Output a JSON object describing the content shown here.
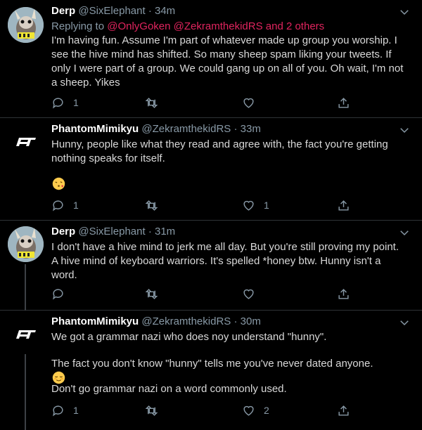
{
  "tweets": [
    {
      "display_name": "Derp",
      "handle": "@SixElephant",
      "sep": "·",
      "time": "34m",
      "replying_label": "Replying to",
      "replying_users": "@OnlyGoken @ZekramthekidRS",
      "replying_and": "and 2 others",
      "text": "I'm having fun. Assume I'm part of whatever made up group you worship. I see the hive mind has shifted. So many sheep spam liking your tweets. If only I were part of a group. We could gang up on all of you. Oh wait, I'm not a sheep. Yikes",
      "reply_count": "1",
      "retweet_count": "",
      "like_count": ""
    },
    {
      "display_name": "PhantomMimikyu",
      "handle": "@ZekramthekidRS",
      "sep": "·",
      "time": "33m",
      "text": "Hunny, people like what they read and agree with, the fact you're getting nothing speaks for itself.",
      "emoji": "face-blowing-kiss",
      "reply_count": "1",
      "retweet_count": "",
      "like_count": "1"
    },
    {
      "display_name": "Derp",
      "handle": "@SixElephant",
      "sep": "·",
      "time": "31m",
      "text": "I don't have a hive mind to jerk me all day. But you're still proving my point. A hive mind of keyboard warriors. It's spelled *honey btw. Hunny isn't a word.",
      "reply_count": "",
      "retweet_count": "",
      "like_count": ""
    },
    {
      "display_name": "PhantomMimikyu",
      "handle": "@ZekramthekidRS",
      "sep": "·",
      "time": "30m",
      "text_line1": "We got a grammar nazi who does noy understand \"hunny\".",
      "text_line2": "The fact you don't know \"hunny\" tells me you've never dated anyone.",
      "emoji": "relieved-face",
      "text_line3": "Don't go grammar nazi on a word commonly used.",
      "reply_count": "1",
      "retweet_count": "",
      "like_count": "2"
    }
  ],
  "colors": {
    "background": "#000000",
    "name": "#ffffff",
    "muted": "#8899a6",
    "text": "#d9d9d9",
    "link": "#e0245e",
    "divider": "#2f3336"
  },
  "icons": [
    "reply-icon",
    "retweet-icon",
    "like-icon",
    "share-icon",
    "chevron-down-icon"
  ]
}
